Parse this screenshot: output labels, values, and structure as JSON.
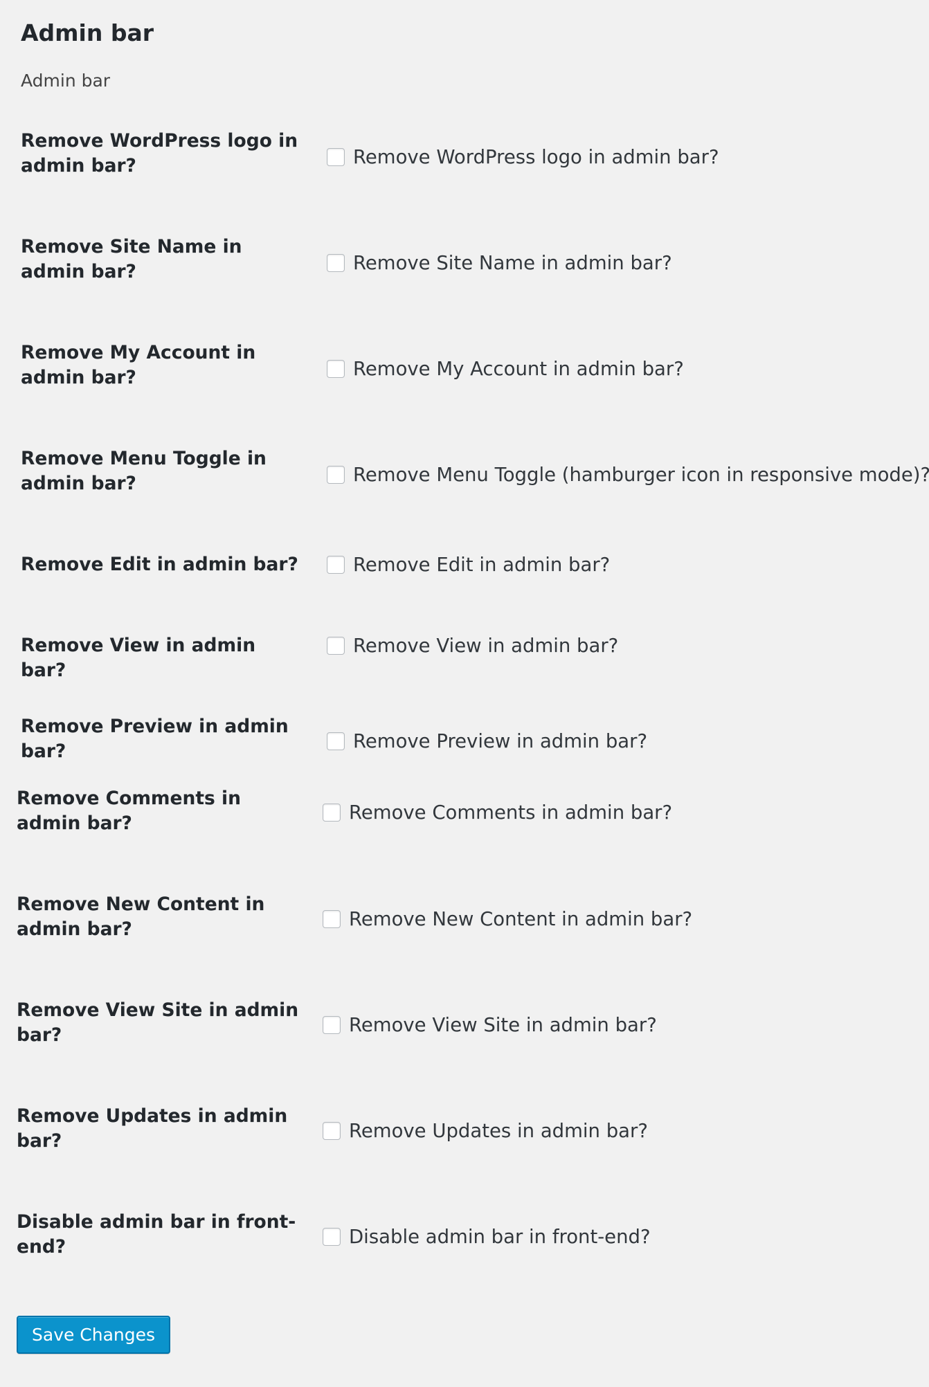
{
  "page": {
    "heading": "Admin bar",
    "section_description": "Admin bar"
  },
  "settings": [
    {
      "label": "Remove WordPress logo in admin bar?",
      "checkbox_label": "Remove WordPress logo in admin bar?",
      "checked": false
    },
    {
      "label": "Remove Site Name in admin bar?",
      "checkbox_label": "Remove Site Name in admin bar?",
      "checked": false
    },
    {
      "label": "Remove My Account in admin bar?",
      "checkbox_label": "Remove My Account in admin bar?",
      "checked": false
    },
    {
      "label": "Remove Menu Toggle in admin bar?",
      "checkbox_label": "Remove Menu Toggle (hamburger icon in responsive mode)?",
      "checked": false
    },
    {
      "label": "Remove Edit in admin bar?",
      "checkbox_label": "Remove Edit in admin bar?",
      "checked": false
    },
    {
      "label": "Remove View in admin bar?",
      "checkbox_label": "Remove View in admin bar?",
      "checked": false
    },
    {
      "label": "Remove Preview in admin bar?",
      "checkbox_label": "Remove Preview in admin bar?",
      "checked": false
    },
    {
      "label": "Remove Comments in admin bar?",
      "checkbox_label": "Remove Comments in admin bar?",
      "checked": false
    },
    {
      "label": "Remove New Content in admin bar?",
      "checkbox_label": "Remove New Content in admin bar?",
      "checked": false
    },
    {
      "label": "Remove View Site in admin bar?",
      "checkbox_label": "Remove View Site in admin bar?",
      "checked": false
    },
    {
      "label": "Remove Updates in admin bar?",
      "checkbox_label": "Remove Updates in admin bar?",
      "checked": false
    },
    {
      "label": "Disable admin bar in front-end?",
      "checkbox_label": "Disable admin bar in front-end?",
      "checked": false
    }
  ],
  "actions": {
    "save_label": "Save Changes"
  },
  "colors": {
    "page_background": "#f1f1f1",
    "primary_button": "#0b93cc",
    "primary_button_border": "#0073aa"
  }
}
